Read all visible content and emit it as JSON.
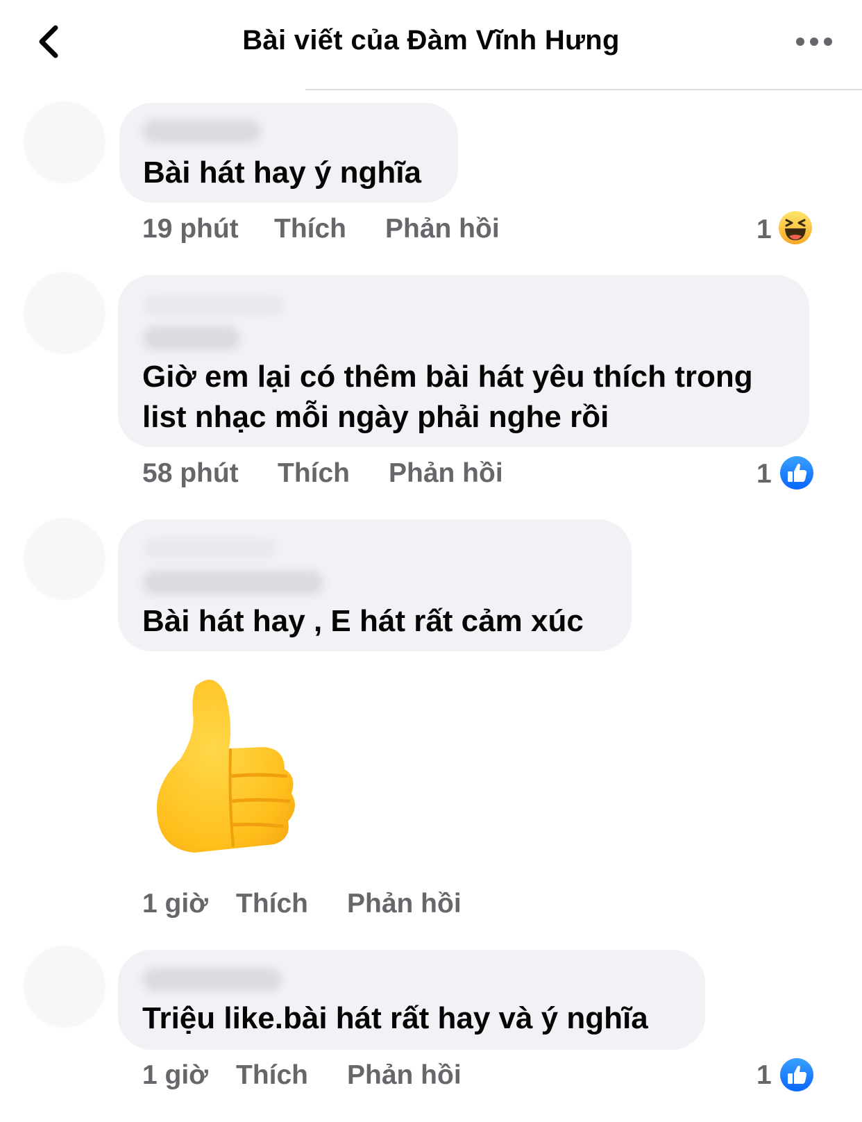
{
  "header": {
    "title": "Bài viết của Đàm Vĩnh Hưng",
    "back_icon": "chevron-left-icon",
    "more_icon": "more-horizontal-icon"
  },
  "comments": [
    {
      "text": "Bài hát hay ý nghĩa",
      "time": "19 phút",
      "like_label": "Thích",
      "reply_label": "Phản hồi",
      "reaction_count": "1",
      "reaction_icon": "haha-emoji-icon"
    },
    {
      "text_line1": "Giờ em lại có thêm bài hát yêu thích trong",
      "text_line2": "list nhạc mỗi ngày phải nghe rồi",
      "time": "58 phút",
      "like_label": "Thích",
      "reply_label": "Phản hồi",
      "reaction_count": "1",
      "reaction_icon": "like-reaction-icon"
    },
    {
      "text": "Bài hát hay , E hát rất cảm xúc",
      "sticker": "thumbs-up-sticker",
      "time": "1 giờ",
      "like_label": "Thích",
      "reply_label": "Phản hồi"
    },
    {
      "text": "Triệu like.bài hát rất hay và ý nghĩa",
      "time": "1 giờ",
      "like_label": "Thích",
      "reply_label": "Phản hồi",
      "reaction_count": "1",
      "reaction_icon": "like-reaction-icon"
    }
  ],
  "colors": {
    "bubble": "#f0f2f5",
    "meta_text": "#65676b",
    "like_blue": "#1877f2",
    "haha_yellow": "#f7b928"
  }
}
